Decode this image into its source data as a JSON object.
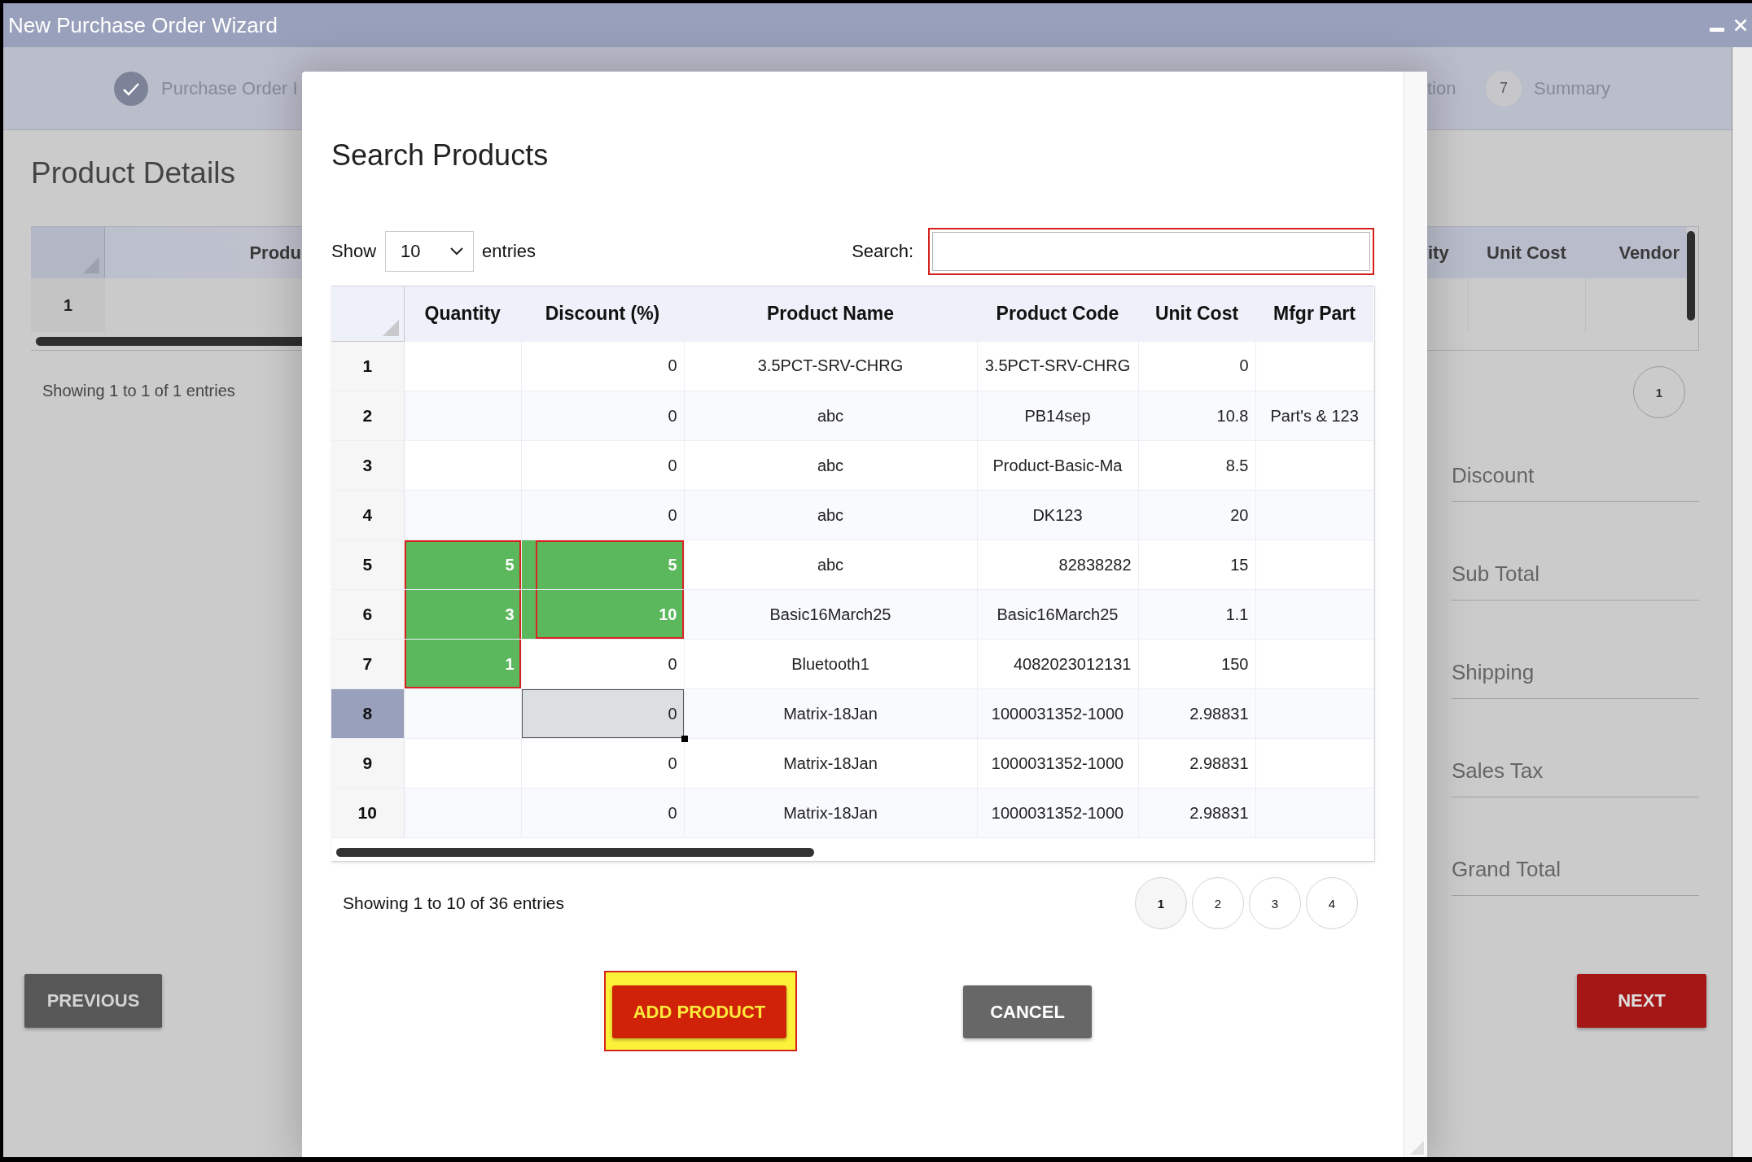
{
  "window": {
    "title": "New Purchase Order Wizard"
  },
  "wizard": {
    "steps": [
      {
        "label": "Purchase Order I",
        "completed": true
      },
      {
        "label": "tion",
        "completed": false
      },
      {
        "number": "7",
        "label": "Summary",
        "completed": false
      }
    ],
    "heading": "Product Details",
    "table": {
      "left_columns": [
        "Produ"
      ],
      "right_columns": [
        "ity",
        "Unit Cost",
        "Vendor"
      ],
      "rows": [
        {
          "number": "1"
        }
      ]
    },
    "info": "Showing 1 to 1 of 1 entries",
    "pages": [
      {
        "label": "1",
        "selected": true
      }
    ],
    "summary_fields": [
      {
        "placeholder": "Discount"
      },
      {
        "placeholder": "Sub Total"
      },
      {
        "placeholder": "Shipping"
      },
      {
        "placeholder": "Sales Tax"
      },
      {
        "placeholder": "Grand Total"
      }
    ],
    "buttons": [
      {
        "label": "PREVIOUS",
        "kind": "secondary"
      },
      {
        "label": "NEXT",
        "kind": "primary"
      }
    ]
  },
  "modal": {
    "title": "Search Products",
    "length_menu": {
      "before": "Show",
      "value": "10",
      "after": "entries"
    },
    "search": {
      "label": "Search:",
      "highlighted": true
    },
    "table": {
      "columns": [
        "Quantity",
        "Discount (%)",
        "Product Name",
        "Product Code",
        "Unit Cost",
        "Mfgr Part"
      ],
      "rows": [
        {
          "number": "1",
          "selected": false,
          "quantity": {
            "edited": false,
            "outlined": false,
            "active": false
          },
          "discount": {
            "value": "0",
            "edited": false,
            "outlined": false,
            "active": false
          },
          "product_name": "3.5PCT-SRV-CHRG",
          "product_code": {
            "value": "3.5PCT-SRV-CHRG",
            "kind": "text"
          },
          "unit_cost": "0"
        },
        {
          "number": "2",
          "selected": false,
          "quantity": {
            "edited": false,
            "outlined": false,
            "active": false
          },
          "discount": {
            "value": "0",
            "edited": false,
            "outlined": false,
            "active": false
          },
          "product_name": "abc",
          "product_code": {
            "value": "PB14sep",
            "kind": "text"
          },
          "unit_cost": "10.8",
          "mfgr_part": "Part's & 123"
        },
        {
          "number": "3",
          "selected": false,
          "quantity": {
            "edited": false,
            "outlined": false,
            "active": false
          },
          "discount": {
            "value": "0",
            "edited": false,
            "outlined": false,
            "active": false
          },
          "product_name": "abc",
          "product_code": {
            "value": "Product-Basic-Ma",
            "kind": "text"
          },
          "unit_cost": "8.5"
        },
        {
          "number": "4",
          "selected": false,
          "quantity": {
            "edited": false,
            "outlined": false,
            "active": false
          },
          "discount": {
            "value": "0",
            "edited": false,
            "outlined": false,
            "active": false
          },
          "product_name": "abc",
          "product_code": {
            "value": "DK123",
            "kind": "text"
          },
          "unit_cost": "20"
        },
        {
          "number": "5",
          "selected": false,
          "quantity": {
            "value": "5",
            "edited": true,
            "outlined": true,
            "active": false
          },
          "discount": {
            "value": "5",
            "edited": true,
            "outlined": true,
            "active": false
          },
          "product_name": "abc",
          "product_code": {
            "value": "82838282",
            "kind": "numeric"
          },
          "unit_cost": "15"
        },
        {
          "number": "6",
          "selected": false,
          "quantity": {
            "value": "3",
            "edited": true,
            "outlined": true,
            "active": false
          },
          "discount": {
            "value": "10",
            "edited": true,
            "outlined": true,
            "active": false
          },
          "product_name": "Basic16March25",
          "product_code": {
            "value": "Basic16March25",
            "kind": "text"
          },
          "unit_cost": "1.1"
        },
        {
          "number": "7",
          "selected": false,
          "quantity": {
            "value": "1",
            "edited": true,
            "outlined": true,
            "active": false
          },
          "discount": {
            "value": "0",
            "edited": false,
            "outlined": false,
            "active": false
          },
          "product_name": "Bluetooth1",
          "product_code": {
            "value": "4082023012131",
            "kind": "numeric"
          },
          "unit_cost": "150"
        },
        {
          "number": "8",
          "selected": true,
          "quantity": {
            "edited": false,
            "outlined": false,
            "active": false
          },
          "discount": {
            "value": "0",
            "edited": false,
            "outlined": false,
            "active": true
          },
          "product_name": "Matrix-18Jan",
          "product_code": {
            "value": "1000031352-1000",
            "kind": "text"
          },
          "unit_cost": "2.98831"
        },
        {
          "number": "9",
          "selected": false,
          "quantity": {
            "edited": false,
            "outlined": false,
            "active": false
          },
          "discount": {
            "value": "0",
            "edited": false,
            "outlined": false,
            "active": false
          },
          "product_name": "Matrix-18Jan",
          "product_code": {
            "value": "1000031352-1000",
            "kind": "text"
          },
          "unit_cost": "2.98831"
        },
        {
          "number": "10",
          "selected": false,
          "quantity": {
            "edited": false,
            "outlined": false,
            "active": false
          },
          "discount": {
            "value": "0",
            "edited": false,
            "outlined": false,
            "active": false
          },
          "product_name": "Matrix-18Jan",
          "product_code": {
            "value": "1000031352-1000",
            "kind": "text"
          },
          "unit_cost": "2.98831"
        }
      ]
    },
    "info": "Showing 1 to 10 of 36 entries",
    "pages": [
      {
        "label": "1",
        "selected": true
      },
      {
        "label": "2",
        "selected": false
      },
      {
        "label": "3",
        "selected": false
      },
      {
        "label": "4",
        "selected": false
      }
    ],
    "buttons": [
      {
        "label": "ADD PRODUCT",
        "kind": "primary",
        "highlighted": true
      },
      {
        "label": "CANCEL",
        "kind": "secondary",
        "highlighted": false
      }
    ]
  }
}
